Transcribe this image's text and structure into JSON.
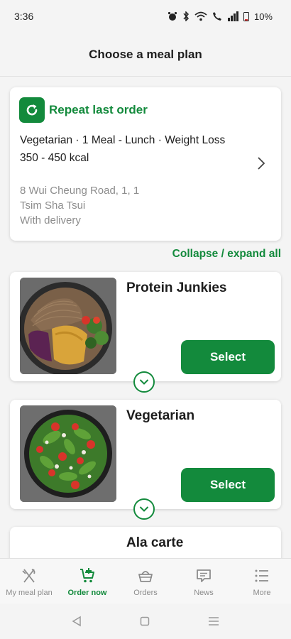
{
  "status_bar": {
    "time": "3:36",
    "battery": "10%"
  },
  "header": {
    "title": "Choose a meal plan"
  },
  "repeat_order": {
    "title": "Repeat last order",
    "description": "Vegetarian · 1 Meal - Lunch · Weight Loss 350 - 450 kcal",
    "address_line1": "8 Wui Cheung Road, 1, 1",
    "address_line2": "Tsim Sha Tsui",
    "delivery": "With delivery"
  },
  "collapse_link": "Collapse / expand all",
  "plans": [
    {
      "name": "Protein Junkies",
      "select_label": "Select",
      "image": "protein-bowl"
    },
    {
      "name": "Vegetarian",
      "select_label": "Select",
      "image": "salad-bowl"
    },
    {
      "name": "Ala carte"
    }
  ],
  "bottom_nav": [
    {
      "label": "My meal plan",
      "icon": "cutlery-icon",
      "active": false
    },
    {
      "label": "Order now",
      "icon": "cart-add-icon",
      "active": true
    },
    {
      "label": "Orders",
      "icon": "basket-icon",
      "active": false
    },
    {
      "label": "News",
      "icon": "chat-icon",
      "active": false
    },
    {
      "label": "More",
      "icon": "list-icon",
      "active": false
    }
  ],
  "colors": {
    "accent": "#138a3c",
    "background": "#f4f4f4"
  }
}
